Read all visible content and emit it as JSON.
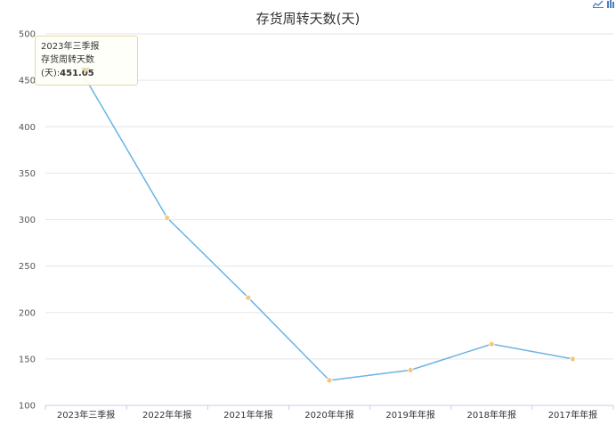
{
  "chart_data": {
    "type": "line",
    "title": "存货周转天数(天)",
    "categories": [
      "2023年三季报",
      "2022年年报",
      "2021年年报",
      "2020年年报",
      "2019年年报",
      "2018年年报",
      "2017年年报"
    ],
    "series": [
      {
        "values": [
          451.05,
          302,
          216,
          127,
          138,
          166,
          150
        ]
      }
    ],
    "yticks": [
      100,
      150,
      200,
      250,
      300,
      350,
      400,
      450,
      500
    ],
    "ylim": [
      100,
      500
    ],
    "grid": true,
    "colors": {
      "line": "#6bb3e4",
      "point": "#f5c77e",
      "grid": "#e6e6e6",
      "axis": "#c9cde8"
    }
  },
  "tooltip": {
    "period": "2023年三季报",
    "label": "存货周转天数(天):",
    "value": "451.05"
  },
  "toolbox": {
    "icons": [
      "line-chart-icon",
      "bar-chart-icon"
    ]
  }
}
